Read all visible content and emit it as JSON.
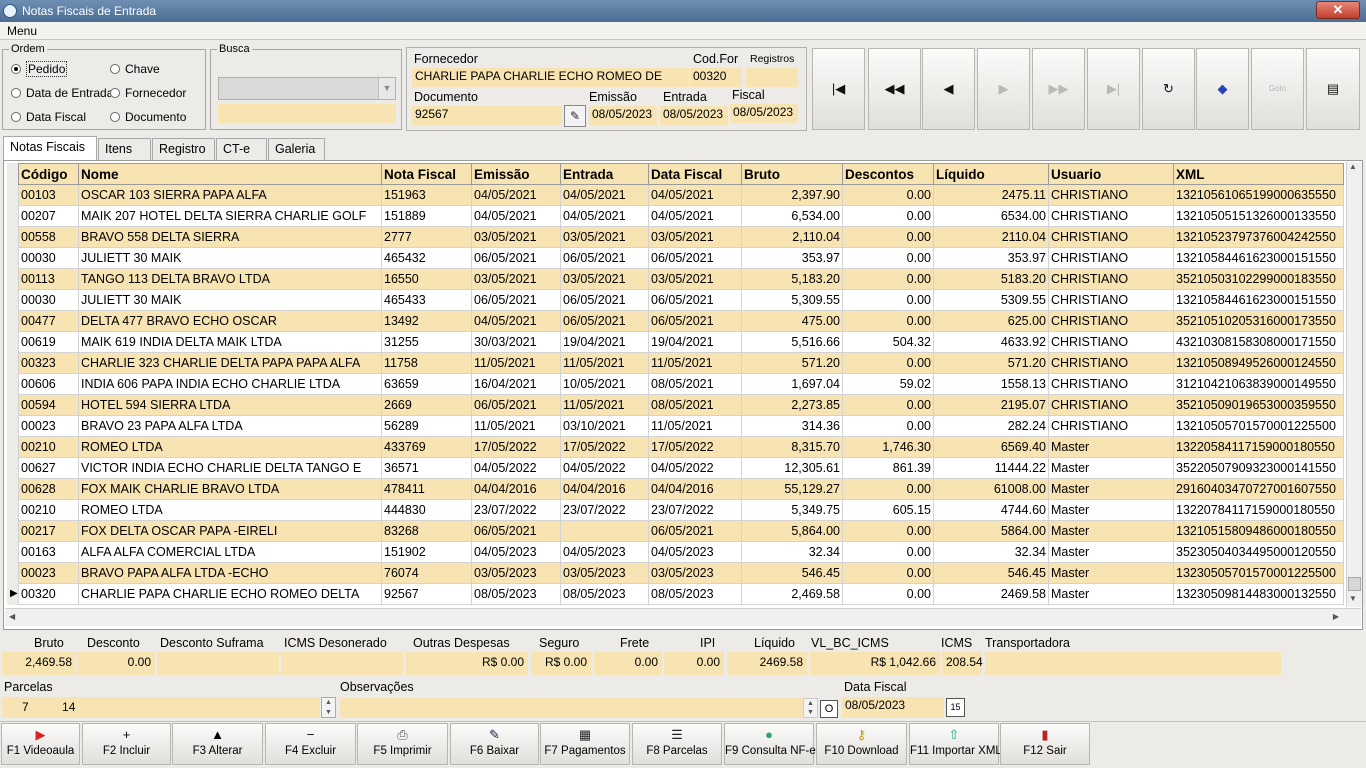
{
  "window": {
    "title": "Notas Fiscais de Entrada",
    "close_label": "✕"
  },
  "menu": {
    "label": "Menu"
  },
  "ordem": {
    "legend": "Ordem",
    "options": [
      {
        "label": "Pedido",
        "checked": true
      },
      {
        "label": "Chave",
        "checked": false
      },
      {
        "label": "Data de Entrada",
        "checked": false
      },
      {
        "label": "Fornecedor",
        "checked": false
      },
      {
        "label": "Data Fiscal",
        "checked": false
      },
      {
        "label": "Documento",
        "checked": false
      }
    ]
  },
  "busca": {
    "legend": "Busca",
    "select_value": "",
    "input_value": ""
  },
  "header": {
    "fornecedor_label": "Fornecedor",
    "fornecedor_value": "CHARLIE PAPA CHARLIE ECHO ROMEO DE",
    "codfor_label": "Cod.For",
    "codfor_value": "00320",
    "registros_label": "Registros",
    "registros_value": "",
    "documento_label": "Documento",
    "documento_value": "92567",
    "emissao_label": "Emissão",
    "emissao_value": "08/05/2023",
    "entrada_label": "Entrada",
    "entrada_value": "08/05/2023",
    "fiscal_label": "Fiscal",
    "fiscal_value": "08/05/2023"
  },
  "nav_buttons": [
    {
      "name": "first-record-button",
      "glyph": "|◀",
      "enabled": true
    },
    {
      "name": "prior-page-button",
      "glyph": "◀◀",
      "enabled": true
    },
    {
      "name": "prior-record-button",
      "glyph": "◀",
      "enabled": true
    },
    {
      "name": "next-record-button",
      "glyph": "▶",
      "enabled": false
    },
    {
      "name": "next-page-button",
      "glyph": "▶▶",
      "enabled": false
    },
    {
      "name": "last-record-button",
      "glyph": "▶|",
      "enabled": false
    },
    {
      "name": "refresh-button",
      "glyph": "↻",
      "enabled": true
    },
    {
      "name": "tag-button",
      "glyph": "◆",
      "enabled": true
    },
    {
      "name": "goto-button",
      "glyph": "Goto",
      "enabled": false
    },
    {
      "name": "form-view-button",
      "glyph": "▤",
      "enabled": true
    }
  ],
  "tabs": [
    "Notas Fiscais",
    "Itens",
    "Registro",
    "CT-e",
    "Galeria"
  ],
  "grid": {
    "columns": [
      "Código",
      "Nome",
      "Nota Fiscal",
      "Emissão",
      "Entrada",
      "Data Fiscal",
      "Bruto",
      "Descontos",
      "Líquido",
      "Usuario",
      "XML"
    ],
    "rows": [
      [
        "00103",
        "OSCAR 103 SIERRA PAPA ALFA",
        "151963",
        "04/05/2021",
        "04/05/2021",
        "04/05/2021",
        "2,397.90",
        "0.00",
        "2475.11",
        "CHRISTIANO",
        "13210561065199000635550"
      ],
      [
        "00207",
        "MAIK 207 HOTEL DELTA SIERRA CHARLIE GOLF",
        "151889",
        "04/05/2021",
        "04/05/2021",
        "04/05/2021",
        "6,534.00",
        "0.00",
        "6534.00",
        "CHRISTIANO",
        "13210505151326000133550"
      ],
      [
        "00558",
        "BRAVO 558 DELTA SIERRA",
        "2777",
        "03/05/2021",
        "03/05/2021",
        "03/05/2021",
        "2,110.04",
        "0.00",
        "2110.04",
        "CHRISTIANO",
        "13210523797376004242550"
      ],
      [
        "00030",
        "JULIETT 30 MAIK",
        "465432",
        "06/05/2021",
        "06/05/2021",
        "06/05/2021",
        "353.97",
        "0.00",
        "353.97",
        "CHRISTIANO",
        "13210584461623000151550"
      ],
      [
        "00113",
        "TANGO 113 DELTA BRAVO LTDA",
        "16550",
        "03/05/2021",
        "03/05/2021",
        "03/05/2021",
        "5,183.20",
        "0.00",
        "5183.20",
        "CHRISTIANO",
        "35210503102299000183550"
      ],
      [
        "00030",
        "JULIETT 30 MAIK",
        "465433",
        "06/05/2021",
        "06/05/2021",
        "06/05/2021",
        "5,309.55",
        "0.00",
        "5309.55",
        "CHRISTIANO",
        "13210584461623000151550"
      ],
      [
        "00477",
        "DELTA 477 BRAVO ECHO OSCAR",
        "13492",
        "04/05/2021",
        "06/05/2021",
        "06/05/2021",
        "475.00",
        "0.00",
        "625.00",
        "CHRISTIANO",
        "35210510205316000173550"
      ],
      [
        "00619",
        "MAIK 619 INDIA DELTA MAIK LTDA",
        "31255",
        "30/03/2021",
        "19/04/2021",
        "19/04/2021",
        "5,516.66",
        "504.32",
        "4633.92",
        "CHRISTIANO",
        "43210308158308000171550"
      ],
      [
        "00323",
        "CHARLIE 323 CHARLIE DELTA PAPA PAPA ALFA",
        "11758",
        "11/05/2021",
        "11/05/2021",
        "11/05/2021",
        "571.20",
        "0.00",
        "571.20",
        "CHRISTIANO",
        "13210508949526000124550"
      ],
      [
        "00606",
        "INDIA 606 PAPA INDIA ECHO CHARLIE LTDA",
        "63659",
        "16/04/2021",
        "10/05/2021",
        "08/05/2021",
        "1,697.04",
        "59.02",
        "1558.13",
        "CHRISTIANO",
        "31210421063839000149550"
      ],
      [
        "00594",
        "HOTEL 594 SIERRA LTDA",
        "2669",
        "06/05/2021",
        "11/05/2021",
        "08/05/2021",
        "2,273.85",
        "0.00",
        "2195.07",
        "CHRISTIANO",
        "35210509019653000359550"
      ],
      [
        "00023",
        "BRAVO 23 PAPA ALFA LTDA",
        "56289",
        "11/05/2021",
        "03/10/2021",
        "11/05/2021",
        "314.36",
        "0.00",
        "282.24",
        "CHRISTIANO",
        "13210505701570001225500"
      ],
      [
        "00210",
        "ROMEO LTDA",
        "433769",
        "17/05/2022",
        "17/05/2022",
        "17/05/2022",
        "8,315.70",
        "1,746.30",
        "6569.40",
        "Master",
        "13220584117159000180550"
      ],
      [
        "00627",
        "VICTOR INDIA ECHO CHARLIE DELTA TANGO E",
        "36571",
        "04/05/2022",
        "04/05/2022",
        "04/05/2022",
        "12,305.61",
        "861.39",
        "11444.22",
        "Master",
        "35220507909323000141550"
      ],
      [
        "00628",
        "FOX MAIK CHARLIE BRAVO LTDA",
        "478411",
        "04/04/2016",
        "04/04/2016",
        "04/04/2016",
        "55,129.27",
        "0.00",
        "61008.00",
        "Master",
        "29160403470727001607550"
      ],
      [
        "00210",
        "ROMEO LTDA",
        "444830",
        "23/07/2022",
        "23/07/2022",
        "23/07/2022",
        "5,349.75",
        "605.15",
        "4744.60",
        "Master",
        "13220784117159000180550"
      ],
      [
        "00217",
        "FOX DELTA OSCAR PAPA -EIRELI",
        "83268",
        "06/05/2021",
        "",
        "06/05/2021",
        "5,864.00",
        "0.00",
        "5864.00",
        "Master",
        "13210515809486000180550"
      ],
      [
        "00163",
        "ALFA ALFA COMERCIAL LTDA",
        "151902",
        "04/05/2023",
        "04/05/2023",
        "04/05/2023",
        "32.34",
        "0.00",
        "32.34",
        "Master",
        "35230504034495000120550"
      ],
      [
        "00023",
        "BRAVO PAPA ALFA LTDA -ECHO",
        "76074",
        "03/05/2023",
        "03/05/2023",
        "03/05/2023",
        "546.45",
        "0.00",
        "546.45",
        "Master",
        "13230505701570001225500"
      ],
      [
        "00320",
        "CHARLIE PAPA CHARLIE ECHO ROMEO DELTA",
        "92567",
        "08/05/2023",
        "08/05/2023",
        "08/05/2023",
        "2,469.58",
        "0.00",
        "2469.58",
        "Master",
        "13230509814483000132550"
      ]
    ],
    "current_row": 19
  },
  "totals": {
    "labels": [
      "Bruto",
      "Desconto",
      "Desconto Suframa",
      "ICMS Desonerado",
      "Outras Despesas",
      "Seguro",
      "Frete",
      "IPI",
      "Líquido",
      "VL_BC_ICMS",
      "ICMS",
      "Transportadora"
    ],
    "values": [
      "2,469.58",
      "0.00",
      "",
      "",
      "R$ 0.00",
      "R$ 0.00",
      "0.00",
      "0.00",
      "2469.58",
      "R$ 1,042.66",
      "208.54",
      ""
    ]
  },
  "parcelas": {
    "label": "Parcelas",
    "count": "7",
    "days": "14"
  },
  "observacoes": {
    "label": "Observações",
    "value": "",
    "button": "O"
  },
  "data_fiscal": {
    "label": "Data Fiscal",
    "value": "08/05/2023"
  },
  "fkeys": [
    {
      "name": "f1-videoaula-button",
      "icon": "▶",
      "label": "F1 Videoaula",
      "color": "#d22"
    },
    {
      "name": "f2-incluir-button",
      "icon": "+",
      "label": "F2 Incluir",
      "color": "#000"
    },
    {
      "name": "f3-alterar-button",
      "icon": "▲",
      "label": "F3 Alterar",
      "color": "#000"
    },
    {
      "name": "f4-excluir-button",
      "icon": "−",
      "label": "F4 Excluir",
      "color": "#000"
    },
    {
      "name": "f5-imprimir-button",
      "icon": "⎙",
      "label": "F5 Imprimir",
      "color": "#555"
    },
    {
      "name": "f6-baixar-button",
      "icon": "✎",
      "label": "F6 Baixar",
      "color": "#225"
    },
    {
      "name": "f7-pagamentos-button",
      "icon": "▦",
      "label": "F7 Pagamentos",
      "color": "#222"
    },
    {
      "name": "f8-parcelas-button",
      "icon": "☰",
      "label": "F8 Parcelas",
      "color": "#222"
    },
    {
      "name": "f9-consulta-nfe-button",
      "icon": "●",
      "label": "F9 Consulta NF-e",
      "color": "#2a6"
    },
    {
      "name": "f10-download-button",
      "icon": "⚷",
      "label": "F10 Download",
      "color": "#c90"
    },
    {
      "name": "f11-importar-xml-button",
      "icon": "⇧",
      "label": "F11 Importar XML",
      "color": "#1a8"
    },
    {
      "name": "f12-sair-button",
      "icon": "▮",
      "label": "F12 Sair",
      "color": "#b22"
    }
  ]
}
